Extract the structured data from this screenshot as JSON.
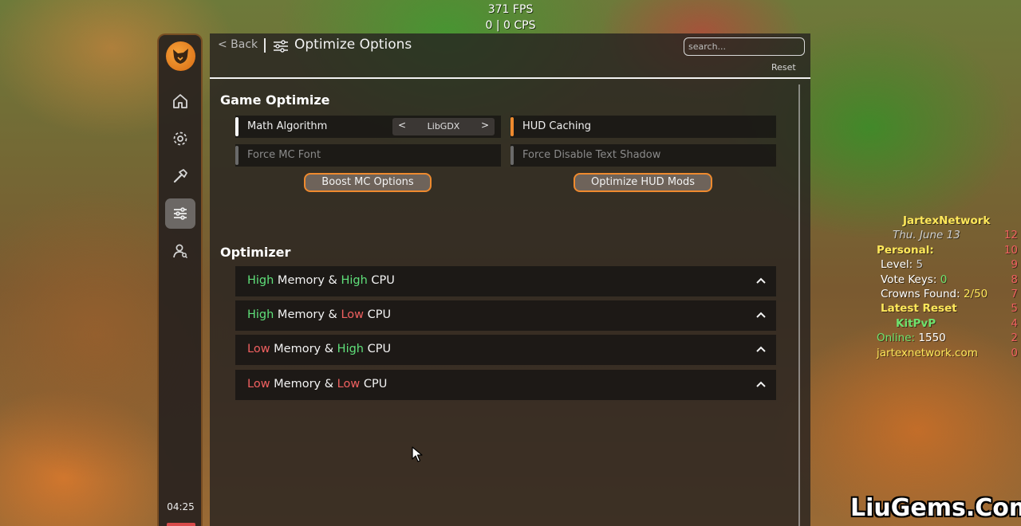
{
  "hud": {
    "fps": "371 FPS",
    "cps": "0 | 0 CPS"
  },
  "sidebar": {
    "items": [
      {
        "icon": "home-icon"
      },
      {
        "icon": "gear-icon"
      },
      {
        "icon": "hammer-icon"
      },
      {
        "icon": "sliders-icon",
        "active": true
      },
      {
        "icon": "user-icon"
      }
    ],
    "clock": "04:25"
  },
  "header": {
    "back_label": "< Back",
    "title": "Optimize Options",
    "search_placeholder": "search...",
    "reset_label": "Reset"
  },
  "game_optimize": {
    "title": "Game Optimize",
    "options": [
      {
        "label": "Math Algorithm",
        "enabled": true,
        "accent": "#ffffff",
        "selector": {
          "prev": "<",
          "value": "LibGDX",
          "next": ">"
        }
      },
      {
        "label": "HUD Caching",
        "enabled": true,
        "accent": "#ee8a2e"
      },
      {
        "label": "Force MC Font",
        "enabled": false,
        "accent": "#6a6a6a"
      },
      {
        "label": "Force Disable Text Shadow",
        "enabled": false,
        "accent": "#6a6a6a"
      }
    ],
    "buttons": {
      "boost": "Boost MC Options",
      "optimize_hud": "Optimize HUD Mods"
    }
  },
  "optimizer": {
    "title": "Optimizer",
    "presets": [
      {
        "mem": "High",
        "mem_level": "high",
        "mid": " Memory & ",
        "cpu": "High",
        "cpu_level": "high",
        "end": " CPU"
      },
      {
        "mem": "High",
        "mem_level": "high",
        "mid": " Memory & ",
        "cpu": "Low",
        "cpu_level": "low",
        "end": " CPU"
      },
      {
        "mem": "Low",
        "mem_level": "low",
        "mid": " Memory & ",
        "cpu": "High",
        "cpu_level": "high",
        "end": " CPU"
      },
      {
        "mem": "Low",
        "mem_level": "low",
        "mid": " Memory & ",
        "cpu": "Low",
        "cpu_level": "low",
        "end": " CPU"
      }
    ]
  },
  "scoreboard": {
    "title": "JartexNetwork",
    "date": "Thu. June 13",
    "date_num": "12",
    "personal": "Personal:",
    "personal_num": "10",
    "level_label": "Level: ",
    "level_value": "5",
    "level_num": "9",
    "votes_label": "Vote Keys: ",
    "votes_value": "0",
    "votes_num": "8",
    "crowns_label": "Crowns Found: ",
    "crowns_value": "2/50",
    "crowns_num": "7",
    "latest": "Latest Reset",
    "latest_num": "5",
    "kit": "KitPvP",
    "kit_num": "4",
    "online_label": "Online: ",
    "online_value": "1550",
    "online_num": "2",
    "site": "jartexnetwork.com",
    "site_num": "0"
  },
  "watermark": "LiuGems.Com",
  "colors": {
    "accent": "#ee8a2e",
    "high": "#5fe07a",
    "low": "#f06060"
  }
}
